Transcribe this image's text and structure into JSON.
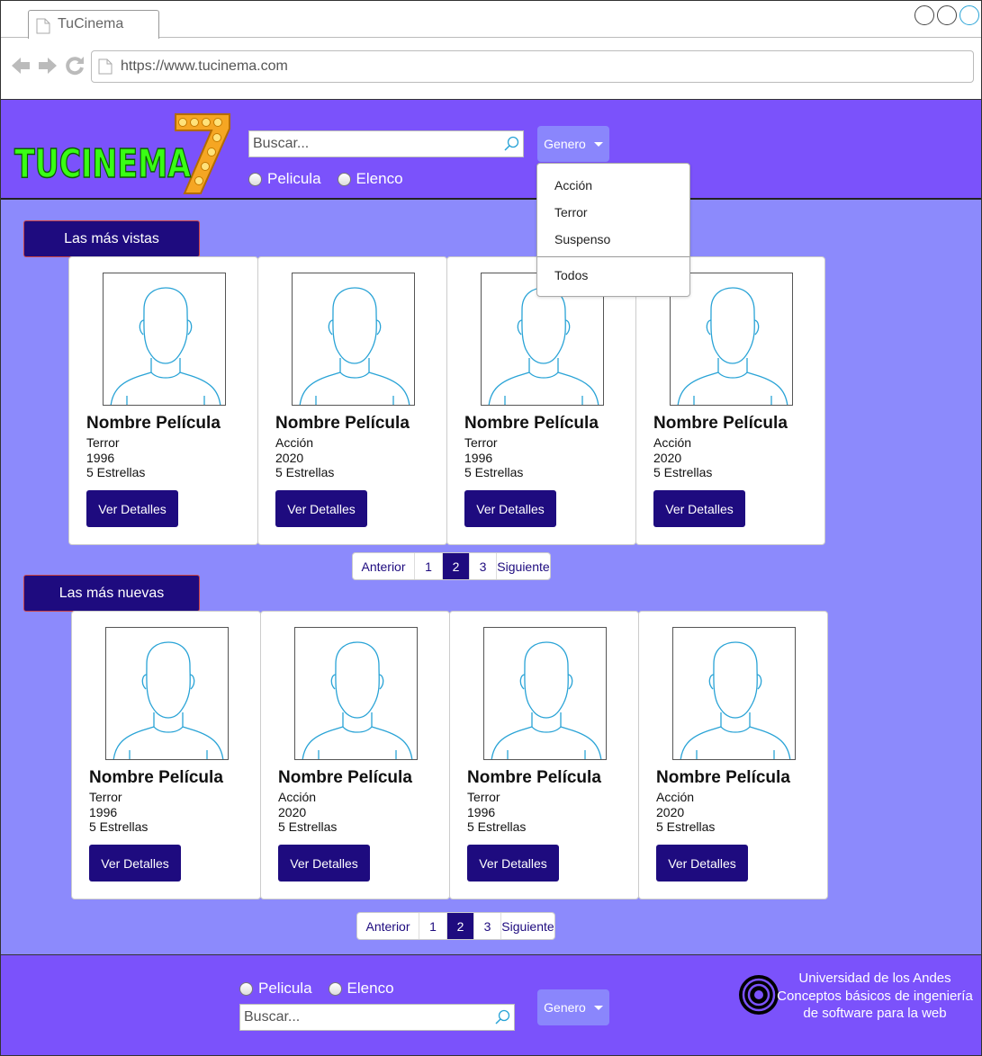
{
  "browser": {
    "tab_title": "TuCinema",
    "url": "https://www.tucinema.com"
  },
  "header": {
    "logo_text": "TUCINEMA",
    "logo_number": "7",
    "search_placeholder": "Buscar...",
    "radio_options": [
      "Pelicula",
      "Elenco"
    ],
    "genre_button": "Genero",
    "genre_menu": {
      "items": [
        "Acción",
        "Terror",
        "Suspenso"
      ],
      "footer_item": "Todos"
    }
  },
  "sections": [
    {
      "title": "Las más vistas",
      "movies": [
        {
          "name": "Nombre Película",
          "genre": "Terror",
          "year": "1996",
          "rating": "5 Estrellas",
          "button": "Ver Detalles"
        },
        {
          "name": "Nombre Película",
          "genre": "Acción",
          "year": "2020",
          "rating": "5 Estrellas",
          "button": "Ver Detalles"
        },
        {
          "name": "Nombre Película",
          "genre": "Terror",
          "year": "1996",
          "rating": "5 Estrellas",
          "button": "Ver Detalles"
        },
        {
          "name": "Nombre Película",
          "genre": "Acción",
          "year": "2020",
          "rating": "5 Estrellas",
          "button": "Ver Detalles"
        }
      ],
      "pager": {
        "prev": "Anterior",
        "pages": [
          "1",
          "2",
          "3"
        ],
        "active": "2",
        "next": "Siguiente"
      }
    },
    {
      "title": "Las más nuevas",
      "movies": [
        {
          "name": "Nombre Película",
          "genre": "Terror",
          "year": "1996",
          "rating": "5 Estrellas",
          "button": "Ver Detalles"
        },
        {
          "name": "Nombre Película",
          "genre": "Acción",
          "year": "2020",
          "rating": "5 Estrellas",
          "button": "Ver Detalles"
        },
        {
          "name": "Nombre Película",
          "genre": "Terror",
          "year": "1996",
          "rating": "5 Estrellas",
          "button": "Ver Detalles"
        },
        {
          "name": "Nombre Película",
          "genre": "Acción",
          "year": "2020",
          "rating": "5 Estrellas",
          "button": "Ver Detalles"
        }
      ],
      "pager": {
        "prev": "Anterior",
        "pages": [
          "1",
          "2",
          "3"
        ],
        "active": "2",
        "next": "Siguiente"
      }
    }
  ],
  "footer": {
    "radio_options": [
      "Pelicula",
      "Elenco"
    ],
    "search_placeholder": "Buscar...",
    "genre_button": "Genero",
    "university_lines": [
      "Universidad de los Andes",
      "Conceptos básicos de ingeniería de software para la web"
    ]
  },
  "colors": {
    "header_bg": "#7b52fb",
    "main_bg": "#8c8afc",
    "accent_dark": "#1e0b7f",
    "logo_green": "#39ff14",
    "logo_orange": "#f5a623"
  },
  "icons": {
    "search": "magnifier-icon",
    "tab_doc": "document-icon",
    "nav": [
      "back-arrow-icon",
      "forward-arrow-icon",
      "reload-icon"
    ],
    "placeholder_photo": "person-placeholder-icon",
    "university": "university-logo-icon"
  }
}
